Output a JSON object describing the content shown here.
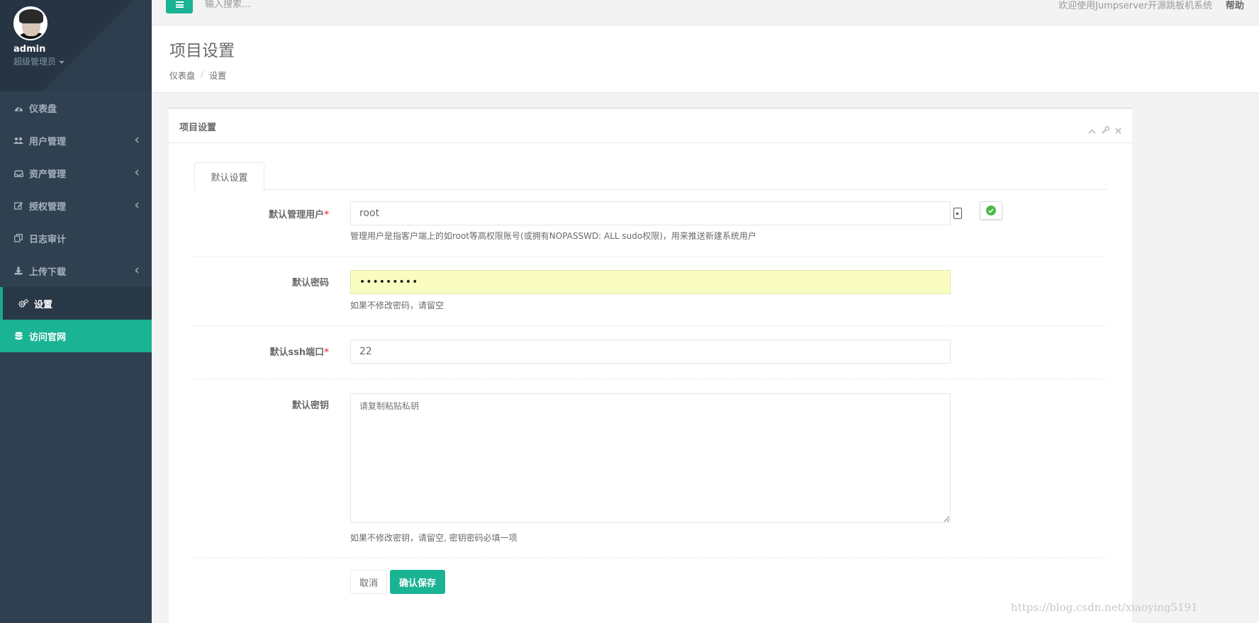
{
  "sidebar": {
    "user": {
      "name": "admin",
      "role": "超级管理员"
    },
    "items": [
      {
        "label": "仪表盘",
        "icon": "dashboard-icon",
        "has_arrow": false
      },
      {
        "label": "用户管理",
        "icon": "users-icon",
        "has_arrow": true
      },
      {
        "label": "资产管理",
        "icon": "inbox-icon",
        "has_arrow": true
      },
      {
        "label": "授权管理",
        "icon": "edit-icon",
        "has_arrow": true
      },
      {
        "label": "日志审计",
        "icon": "copy-icon",
        "has_arrow": false
      },
      {
        "label": "上传下载",
        "icon": "download-icon",
        "has_arrow": true
      },
      {
        "label": "设置",
        "icon": "gears-icon",
        "has_arrow": false,
        "active": true
      },
      {
        "label": "访问官网",
        "icon": "database-icon",
        "has_arrow": false,
        "highlight": true
      }
    ]
  },
  "topbar": {
    "search_placeholder": "输入搜索...",
    "welcome": "欢迎使用Jumpserver开源跳板机系统",
    "help": "帮助"
  },
  "heading": {
    "title": "项目设置",
    "breadcrumb": [
      "仪表盘",
      "设置"
    ]
  },
  "card": {
    "title": "项目设置",
    "tab": "默认设置"
  },
  "form": {
    "admin_user": {
      "label": "默认管理用户",
      "value": "root",
      "help": "管理用户是指客户端上的如root等高权限账号(或拥有NOPASSWD: ALL sudo权限)，用来推送新建系统用户"
    },
    "password": {
      "label": "默认密码",
      "value": "•••••••••",
      "help": "如果不修改密码，请留空"
    },
    "ssh_port": {
      "label": "默认ssh端口",
      "value": "22"
    },
    "private_key": {
      "label": "默认密钥",
      "placeholder": "请复制粘贴私钥",
      "help": "如果不修改密钥，请留空, 密钥密码必填一项"
    },
    "required_mark": "*",
    "cancel": "取消",
    "save": "确认保存"
  },
  "watermark": "https://blog.csdn.net/xiaoying5191",
  "colors": {
    "sidebar": "#2f4050",
    "accent": "#1ab394",
    "autofill": "#fafdc0"
  }
}
